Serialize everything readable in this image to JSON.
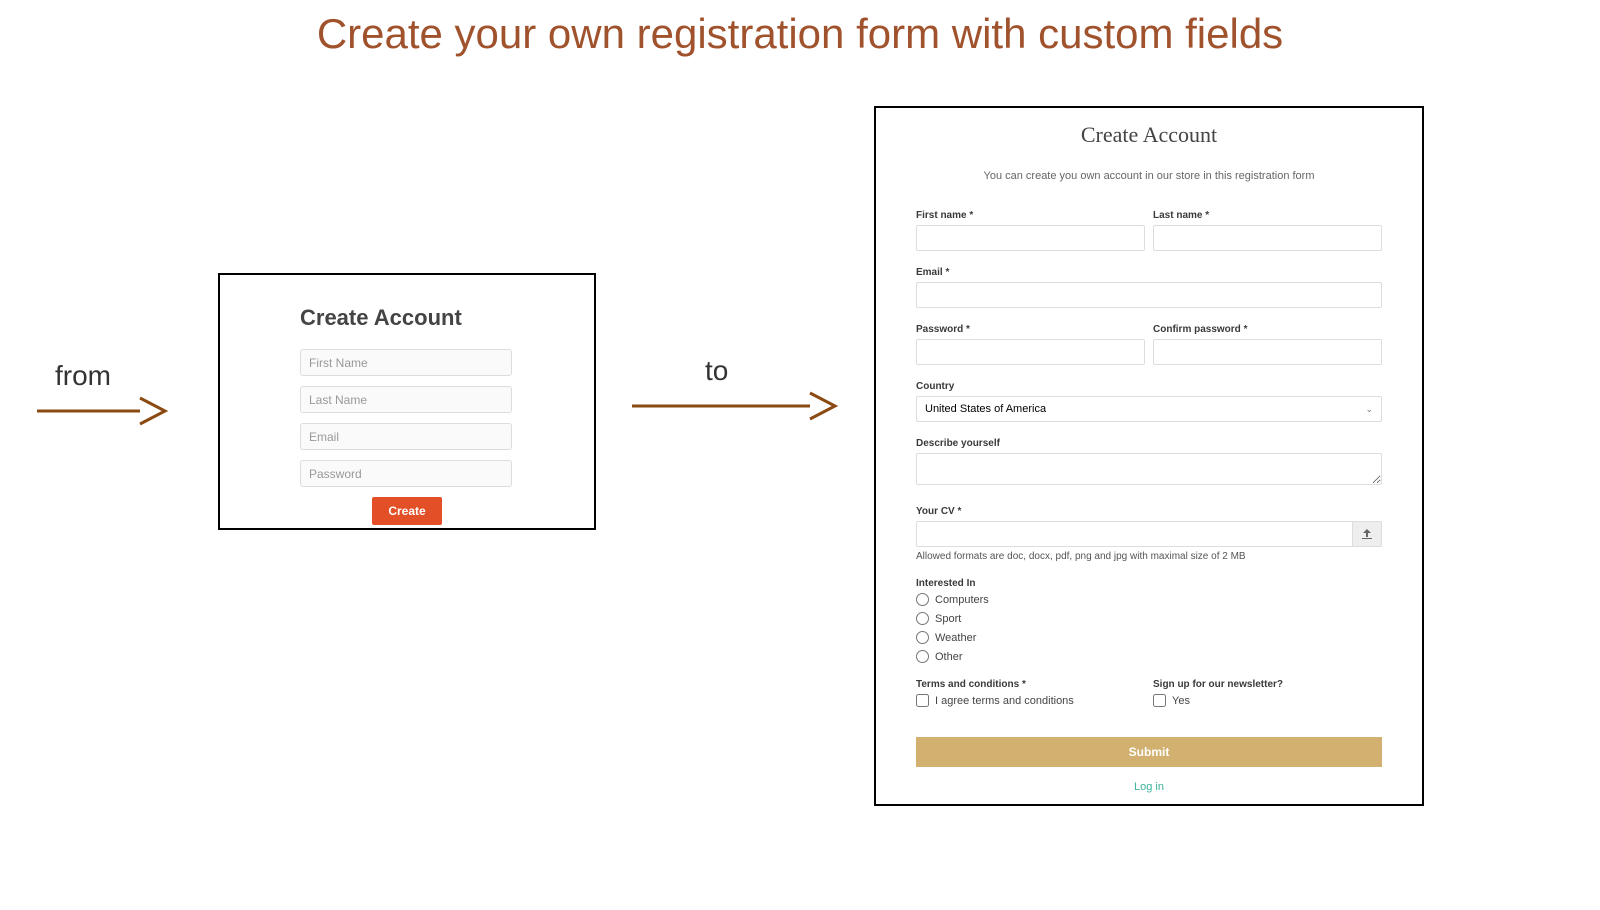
{
  "title": "Create your own registration form with custom fields",
  "arrow_from": "from",
  "arrow_to": "to",
  "simple": {
    "title": "Create Account",
    "first_name_ph": "First Name",
    "last_name_ph": "Last Name",
    "email_ph": "Email",
    "password_ph": "Password",
    "button": "Create"
  },
  "ext": {
    "title": "Create Account",
    "subtitle": "You can create you own account in our store in this registration form",
    "first_name_label": "First name *",
    "last_name_label": "Last name *",
    "email_label": "Email *",
    "password_label": "Password *",
    "confirm_password_label": "Confirm password *",
    "country_label": "Country",
    "country_value": "United States of America",
    "describe_label": "Describe yourself",
    "cv_label": "Your CV *",
    "cv_hint": "Allowed formats are doc, docx, pdf, png and jpg with maximal size of 2 MB",
    "interested_label": "Interested In",
    "interested_options": [
      "Computers",
      "Sport",
      "Weather",
      "Other"
    ],
    "terms_label": "Terms and conditions *",
    "terms_text": "I agree terms and conditions",
    "newsletter_label": "Sign up for our newsletter?",
    "newsletter_text": "Yes",
    "submit_label": "Submit",
    "login_label": "Log in"
  }
}
